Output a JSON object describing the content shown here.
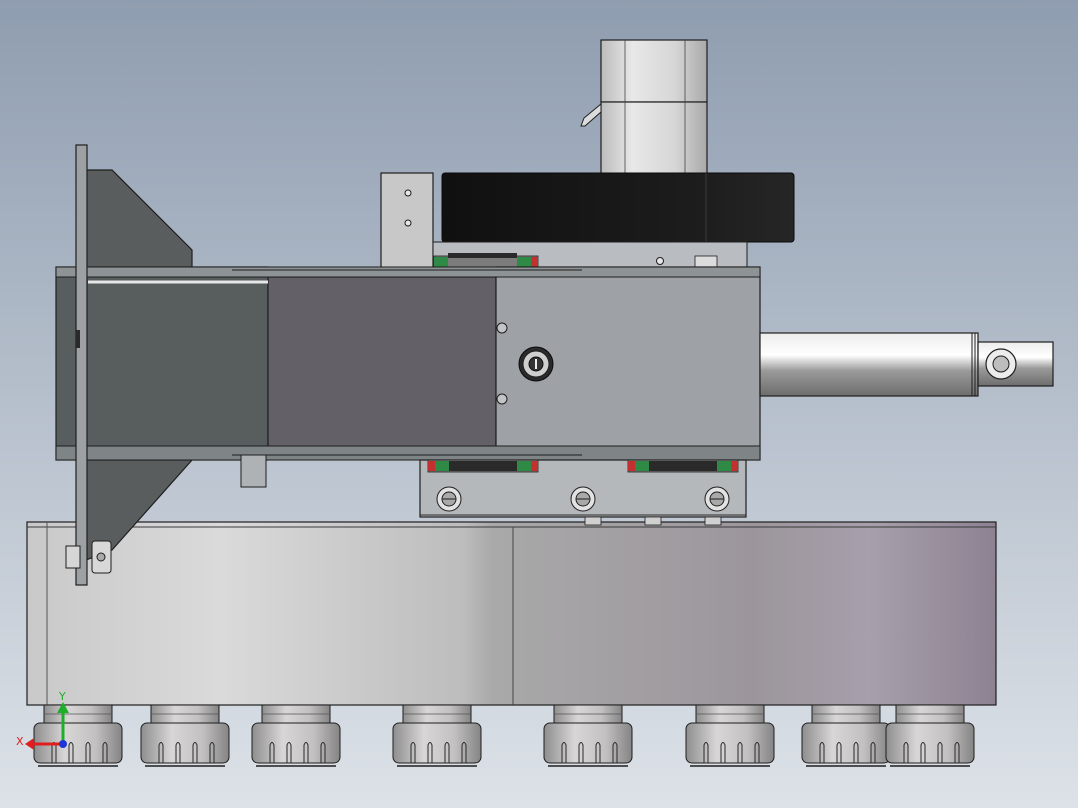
{
  "viewport": {
    "background_top": "#8f9db0",
    "background_bottom": "#dde2e8"
  },
  "triad": {
    "x_label": "X",
    "y_label": "Y",
    "x_color": "#e11d1d",
    "y_color": "#1fae2a",
    "z_color": "#1f35d6"
  },
  "colors": {
    "outline": "#1e1e1e",
    "steel_dark": "#585d5d",
    "steel_purple": "#636068",
    "steel_gray": "#9ea2a6",
    "belt": "#161616",
    "motor": "#d2d2d2",
    "rail_green": "#2f8a45",
    "rail_red": "#c23030",
    "collet": "#b8b6b6"
  }
}
